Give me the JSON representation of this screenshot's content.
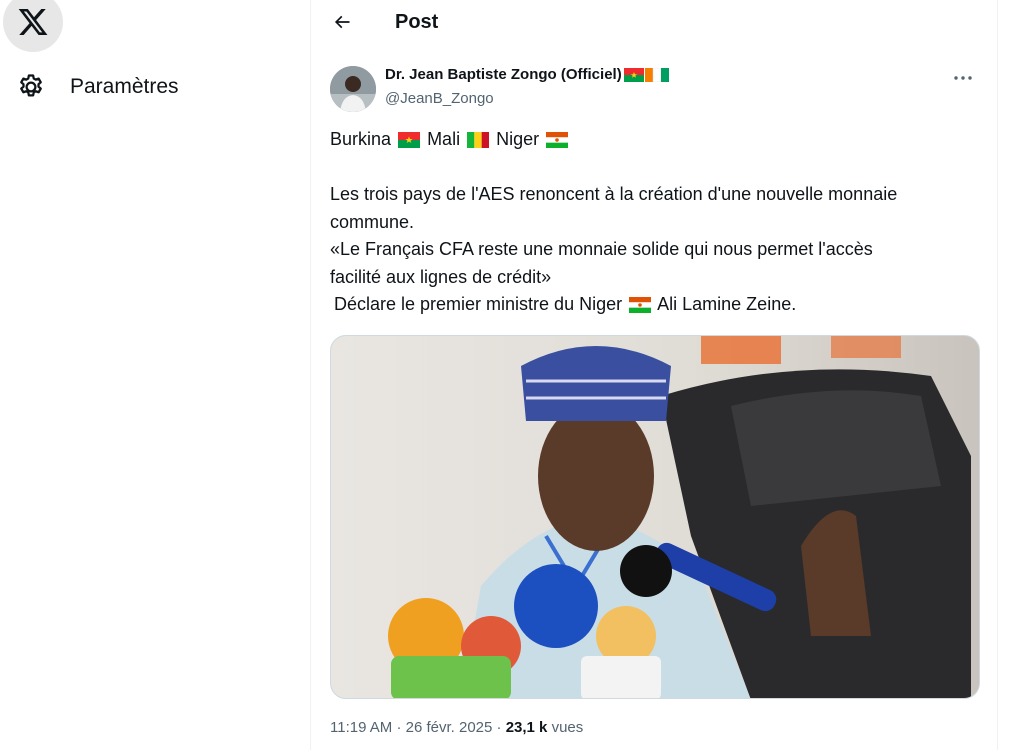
{
  "nav": {
    "logo_icon": "x-logo-icon",
    "settings": {
      "icon": "gear-icon",
      "label": "Paramètres"
    }
  },
  "header": {
    "back_icon": "arrow-left-icon",
    "title": "Post"
  },
  "post": {
    "author_name": "Dr. Jean Baptiste Zongo (Officiel)",
    "author_handle": "@JeanB_Zongo",
    "more_icon": "more-dots-icon",
    "text": {
      "line1_a": "Burkina",
      "line1_b": "Mali",
      "line1_c": "Niger",
      "p2_l1": "Les trois pays de l'AES renoncent à la création d'une nouvelle monnaie",
      "p2_l2": "commune.",
      "p2_l3": "«Le Français CFA reste une monnaie solide qui nous permet l'accès",
      "p2_l4": "facilité aux lignes de crédit»",
      "p2_l5a": "Déclare le premier ministre du Niger",
      "p2_l5b": "Ali Lamine Zeine."
    },
    "meta": {
      "time": "11:19 AM",
      "sep1": "·",
      "date": "26 févr. 2025",
      "sep2": "·",
      "views_count": "23,1 k",
      "views_label": "vues"
    },
    "flags": {
      "burkina": [
        "#ef2b2d",
        "#009e49",
        "#fcd116"
      ],
      "mali": [
        "#14b53a",
        "#fcd116",
        "#ce1126"
      ],
      "niger": [
        "#e05206",
        "#ffffff",
        "#0db02b"
      ],
      "ivory_coast": [
        "#f77f00",
        "#ffffff",
        "#009e60"
      ]
    }
  }
}
